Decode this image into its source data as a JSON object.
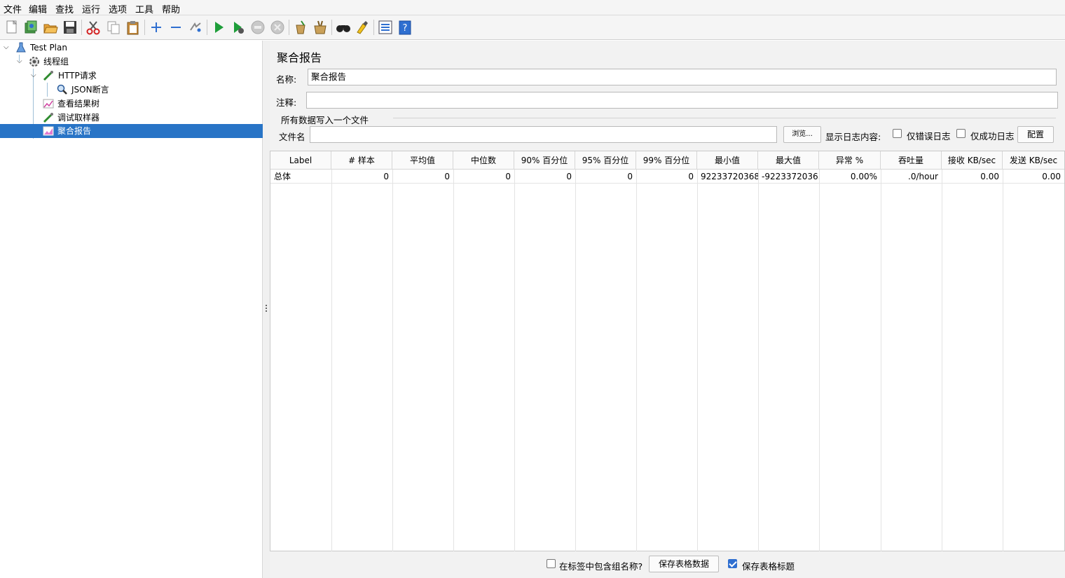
{
  "menu": [
    "文件",
    "编辑",
    "查找",
    "运行",
    "选项",
    "工具",
    "帮助"
  ],
  "toolbar_icons": [
    "new-icon",
    "templates-icon",
    "open-icon",
    "save-icon",
    "cut-icon",
    "copy-icon",
    "paste-icon",
    "expand-icon",
    "collapse-icon",
    "toggle-icon",
    "start-icon",
    "start-no-pause-icon",
    "stop-icon",
    "shutdown-icon",
    "clear-icon",
    "clear-all-icon",
    "search-icon",
    "reset-search-icon",
    "function-helper-icon",
    "help-icon"
  ],
  "tree": {
    "test_plan": "Test Plan",
    "thread_group": "线程组",
    "http_request": "HTTP请求",
    "json_assertion": "JSON断言",
    "view_results_tree": "查看结果树",
    "debug_sampler": "调试取样器",
    "aggregate_report": "聚合报告"
  },
  "panel": {
    "title": "聚合报告",
    "name_label": "名称:",
    "name_value": "聚合报告",
    "comment_label": "注释:",
    "comment_value": "",
    "file_section": "所有数据写入一个文件",
    "filename_label": "文件名",
    "filename_value": "",
    "browse_button": "浏览...",
    "log_label": "显示日志内容:",
    "errors_only": "仅错误日志",
    "success_only": "仅成功日志",
    "configure_button": "配置"
  },
  "table": {
    "headers": [
      "Label",
      "# 样本",
      "平均值",
      "中位数",
      "90% 百分位",
      "95% 百分位",
      "99% 百分位",
      "最小值",
      "最大值",
      "异常 %",
      "吞吐量",
      "接收 KB/sec",
      "发送 KB/sec"
    ],
    "rows": [
      [
        "总体",
        "0",
        "0",
        "0",
        "0",
        "0",
        "0",
        "92233720368...",
        "-9223372036...",
        "0.00%",
        ".0/hour",
        "0.00",
        "0.00"
      ]
    ]
  },
  "bottom": {
    "include_group_label": "在标签中包含组名称?",
    "include_group_checked": false,
    "save_table_button": "保存表格数据",
    "save_header_label": "保存表格标题",
    "save_header_checked": true
  },
  "colors": {
    "selection": "#2874c6",
    "panel_bg": "#f2f2f2"
  }
}
